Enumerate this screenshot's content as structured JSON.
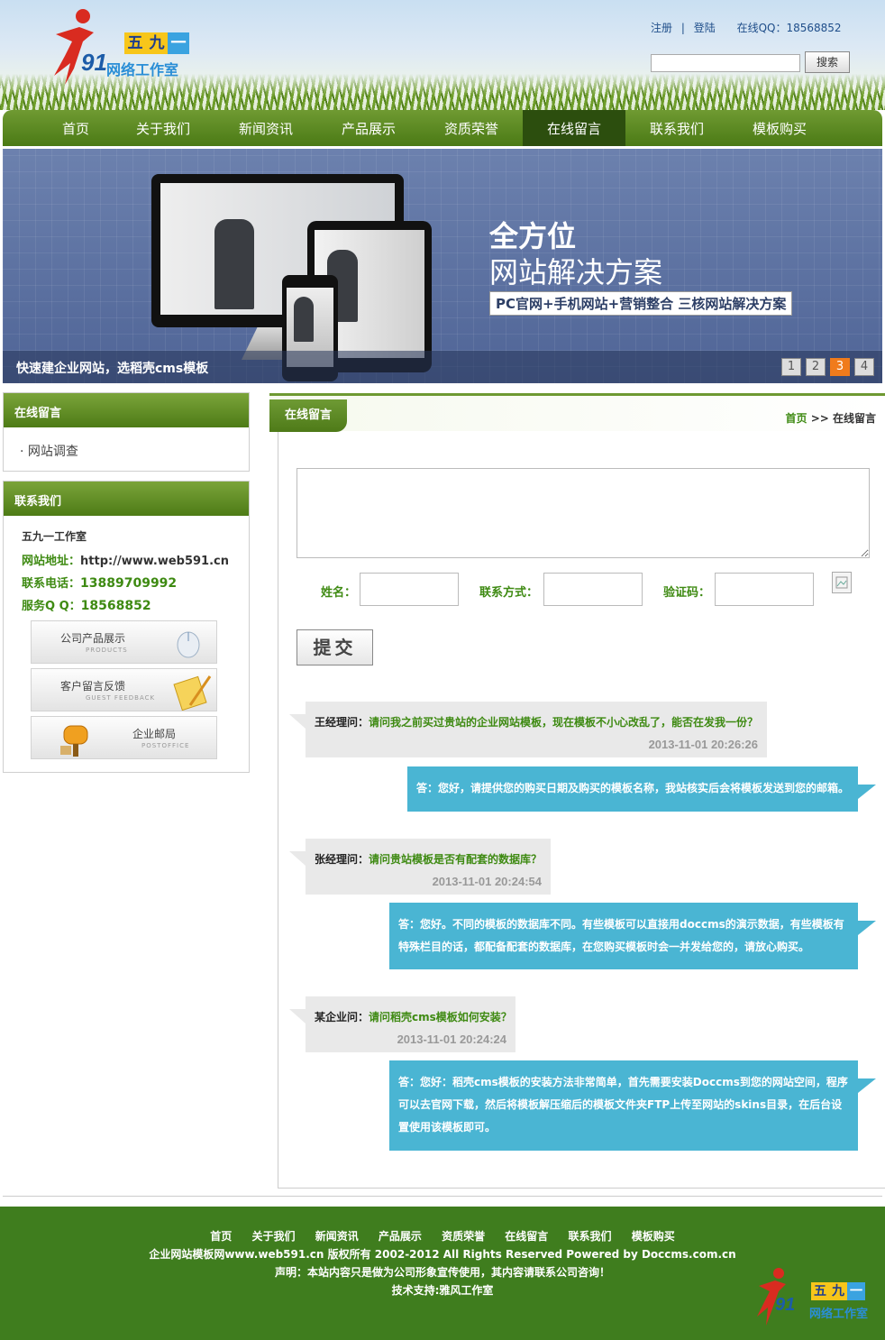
{
  "header": {
    "logo_boxes": [
      "五",
      "九",
      "一"
    ],
    "logo_number": "91",
    "logo_sub": "网络工作室",
    "register": "注册",
    "separator": "|",
    "login": "登陆",
    "qq": "在线QQ：18568852",
    "search_placeholder": "",
    "search_button": "搜索"
  },
  "nav": {
    "items": [
      "首页",
      "关于我们",
      "新闻资讯",
      "产品展示",
      "资质荣誉",
      "在线留言",
      "联系我们",
      "模板购买"
    ],
    "active_index": 5
  },
  "banner": {
    "title1": "全方位",
    "title2": "网站解决方案",
    "subtitle": "PC官网+手机网站+营销整合 三核网站解决方案",
    "caption": "快速建企业网站，选稻壳cms模板",
    "pages": [
      "1",
      "2",
      "3",
      "4"
    ],
    "active_page": "3"
  },
  "sidebar": {
    "box1_title": "在线留言",
    "survey_item": "网站调查",
    "box2_title": "联系我们",
    "studio": "五九一工作室",
    "website_label": "网站地址：",
    "website": "http://www.web591.cn",
    "phone_label": "联系电话：",
    "phone": "13889709992",
    "qq_label": "服务Q Q：",
    "qq": "18568852",
    "buttons": [
      {
        "title": "公司产品展示",
        "sub": "PRODUCTS"
      },
      {
        "title": "客户留言反馈",
        "sub": "GUEST FEEDBACK"
      },
      {
        "title": "企业邮局",
        "sub": "POSTOFFICE"
      }
    ]
  },
  "main": {
    "tab_title": "在线留言",
    "crumb_home": "首页",
    "crumb_sep": ">>",
    "crumb_current": "在线留言",
    "form": {
      "name_label": "姓名：",
      "contact_label": "联系方式：",
      "captcha_label": "验证码：",
      "submit": "提交"
    },
    "messages": [
      {
        "who": "王经理问：",
        "question": "请问我之前买过贵站的企业网站模板，现在模板不小心改乱了，能否在发我一份？",
        "time": "2013-11-01 20:26:26",
        "answer": "答：您好，请提供您的购买日期及购买的模板名称，我站核实后会将模板发送到您的邮箱。"
      },
      {
        "who": "张经理问：",
        "question": "请问贵站模板是否有配套的数据库？",
        "time": "2013-11-01 20:24:54",
        "answer": "答：您好。不同的模板的数据库不同。有些模板可以直接用doccms的演示数据，有些模板有特殊栏目的话，都配备配套的数据库，在您购买模板时会一并发给您的，请放心购买。"
      },
      {
        "who": "某企业问：",
        "question": "请问稻壳cms模板如何安装？",
        "time": "2013-11-01 20:24:24",
        "answer": "答：您好：稻壳cms模板的安装方法非常简单，首先需要安装Doccms到您的网站空间，程序可以去官网下载，然后将模板解压缩后的模板文件夹FTP上传至网站的skins目录，在后台设置使用该模板即可。"
      }
    ]
  },
  "footer": {
    "nav": [
      "首页",
      "关于我们",
      "新闻资讯",
      "产品展示",
      "资质荣誉",
      "在线留言",
      "联系我们",
      "模板购买"
    ],
    "copyright": "企业网站模板网www.web591.cn 版权所有 2002-2012 All Rights Reserved Powered by Doccms.com.cn",
    "statement": "声明：本站内容只是做为公司形象宣传使用，其内容请联系公司咨询！",
    "support": "技术支持:雅风工作室"
  },
  "colors": {
    "green": "#4b7a15",
    "dark_green": "#2c4e0e",
    "answer_blue": "#4ab5d3",
    "orange": "#f07b1c",
    "footer_green": "#3f7d1e"
  }
}
